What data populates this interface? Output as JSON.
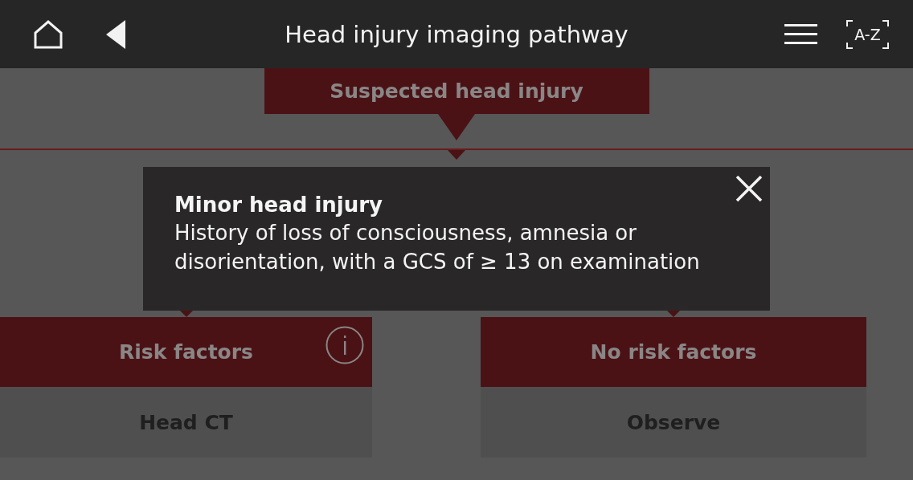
{
  "header": {
    "title": "Head injury imaging pathway",
    "index_button": "A-Z"
  },
  "pathway": {
    "top_node": {
      "label": "Suspected head injury"
    },
    "branches": [
      {
        "label": "Risk factors",
        "info": true,
        "outcome": "Head CT"
      },
      {
        "label": "No risk factors",
        "info": false,
        "outcome": "Observe"
      }
    ]
  },
  "popup": {
    "title": "Minor head injury",
    "text": "History of loss of consciousness, amnesia or disorientation, with a GCS of ≥ 13 on examination"
  }
}
